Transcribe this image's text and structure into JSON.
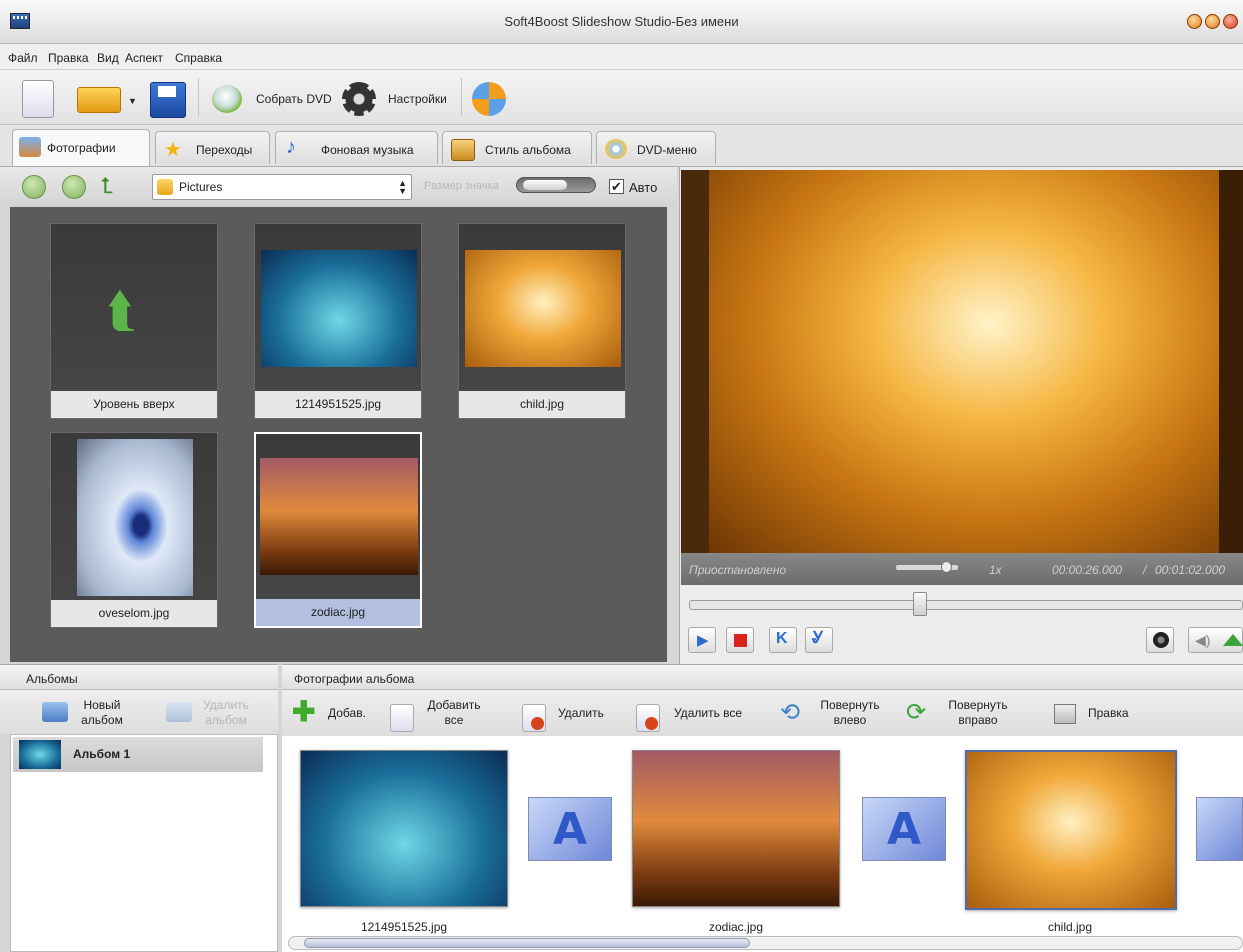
{
  "window": {
    "title": "Soft4Boost Slideshow Studio-Без имени"
  },
  "menu": [
    "Файл",
    "Правка",
    "Вид",
    "Аспект",
    "Справка"
  ],
  "toolbar": {
    "build_dvd": "Собрать DVD",
    "settings": "Настройки"
  },
  "tabs": [
    "Фотографии",
    "Переходы",
    "Фоновая музыка",
    "Стиль альбома",
    "DVD-меню"
  ],
  "browser": {
    "path": "Pictures",
    "icon_size_label": "Размер значка",
    "auto_label": "Авто",
    "auto_checked": true,
    "items": [
      {
        "name": "Уровень вверх",
        "kind": "up-folder"
      },
      {
        "name": "1214951525.jpg",
        "kind": "image"
      },
      {
        "name": "child.jpg",
        "kind": "image"
      },
      {
        "name": "oveselom.jpg",
        "kind": "image"
      },
      {
        "name": "zodiac.jpg",
        "kind": "image",
        "selected": true
      }
    ]
  },
  "preview": {
    "status": "Приостановлено",
    "speed": "1x",
    "time_current": "00:00:26.000",
    "time_separator": "/",
    "time_total": "00:01:02.000"
  },
  "albums": {
    "header": "Альбомы",
    "new_album": "Новый альбом",
    "delete_album": "Удалить альбом",
    "items": [
      "Альбом 1"
    ]
  },
  "album_photos": {
    "header": "Фотографии альбома",
    "add": "Добав.",
    "add_all": "Добавить все",
    "delete": "Удалить",
    "delete_all": "Удалить все",
    "rotate_left": "Повернуть влево",
    "rotate_right": "Повернуть вправо",
    "edit": "Правка",
    "photos": [
      "1214951525.jpg",
      "zodiac.jpg",
      "child.jpg"
    ]
  },
  "colors": {
    "accent_green": "#5aa63a",
    "selection": "#b2bfe0",
    "preview_warm": "#f5b540"
  }
}
